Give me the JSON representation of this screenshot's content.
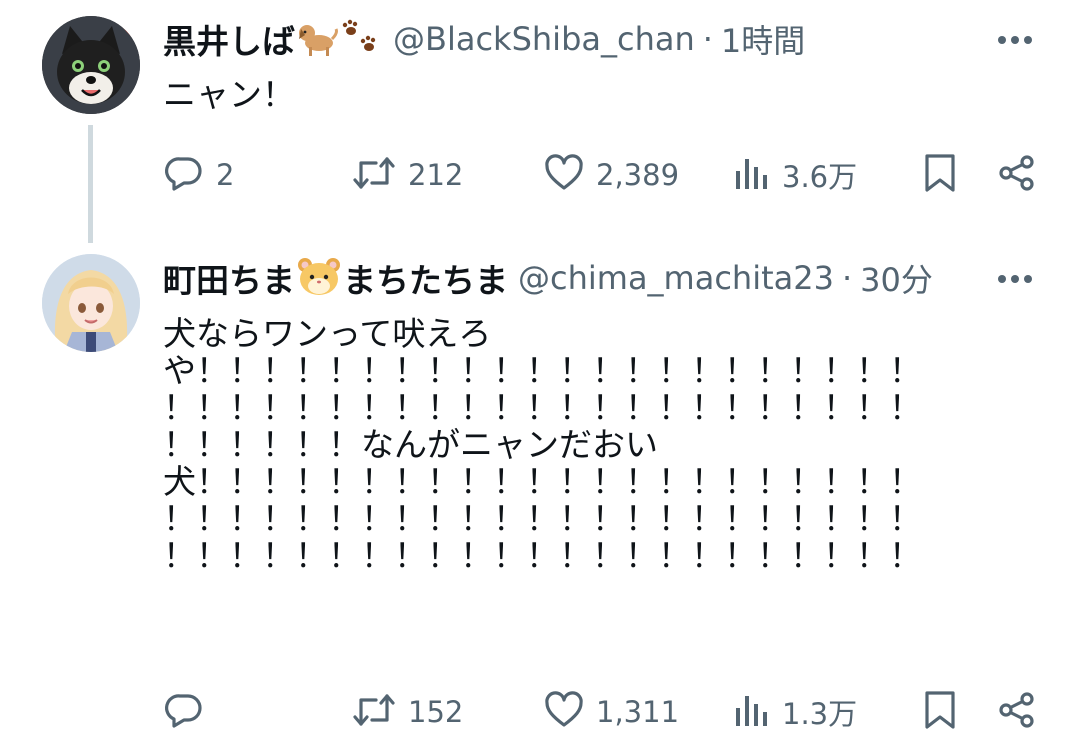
{
  "tweets": [
    {
      "author_name": "黒井しば",
      "author_emoji": [
        "dog-emoji",
        "paw-prints-emoji"
      ],
      "handle": "@BlackShiba_chan",
      "separator": "·",
      "time": "1時間",
      "text": "ニャン！",
      "stats": {
        "replies": "2",
        "retweets": "212",
        "likes": "2,389",
        "views": "3.6万"
      }
    },
    {
      "author_name": "町田ちま",
      "author_name_suffix": "まちたちま",
      "author_emoji": [
        "hamster-face-emoji"
      ],
      "handle": "@chima_machita23",
      "separator": "·",
      "time": "30分",
      "text": "犬ならワンって吠えろ\nや！！！！！！！！！！！！！！！！！！！！！！\n！！！！！！！！！！！！！！！！！！！！！！！\n！！！！！！なんがニャンだおい\n犬！！！！！！！！！！！！！！！！！！！！！！\n！！！！！！！！！！！！！！！！！！！！！！！\n！！！！！！！！！！！！！！！！！！！！！！！",
      "stats": {
        "replies": "",
        "retweets": "152",
        "likes": "1,311",
        "views": "1.3万"
      }
    }
  ],
  "icons": [
    "reply-icon",
    "retweet-icon",
    "like-icon",
    "views-icon",
    "bookmark-icon",
    "share-icon",
    "more-icon"
  ],
  "colors": {
    "text": "#0f1419",
    "secondary": "#536471",
    "thread_line": "#cfd9de",
    "background": "#ffffff"
  }
}
